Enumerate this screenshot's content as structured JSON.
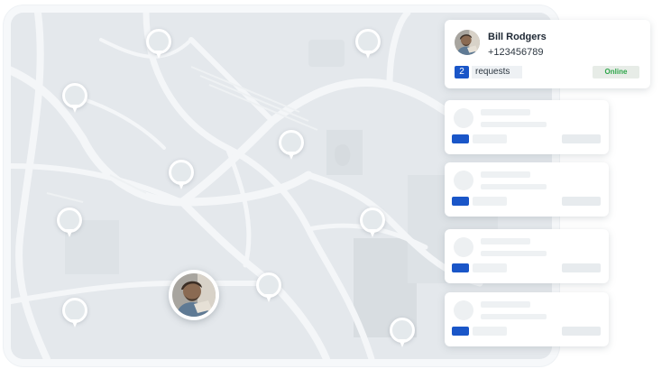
{
  "map": {
    "pins_count": 11
  },
  "profile_card": {
    "name": "Bill Rodgers",
    "phone": "+123456789",
    "requests_count": "2",
    "requests_label": "requests",
    "status": "Online"
  },
  "colors": {
    "accent": "#1a56c8",
    "status_online": "#2ea64a",
    "map_bg": "#e6eaee",
    "road": "#f4f6f8"
  },
  "icons": {
    "map_pin": "map-pin-icon",
    "avatar": "user-avatar"
  }
}
